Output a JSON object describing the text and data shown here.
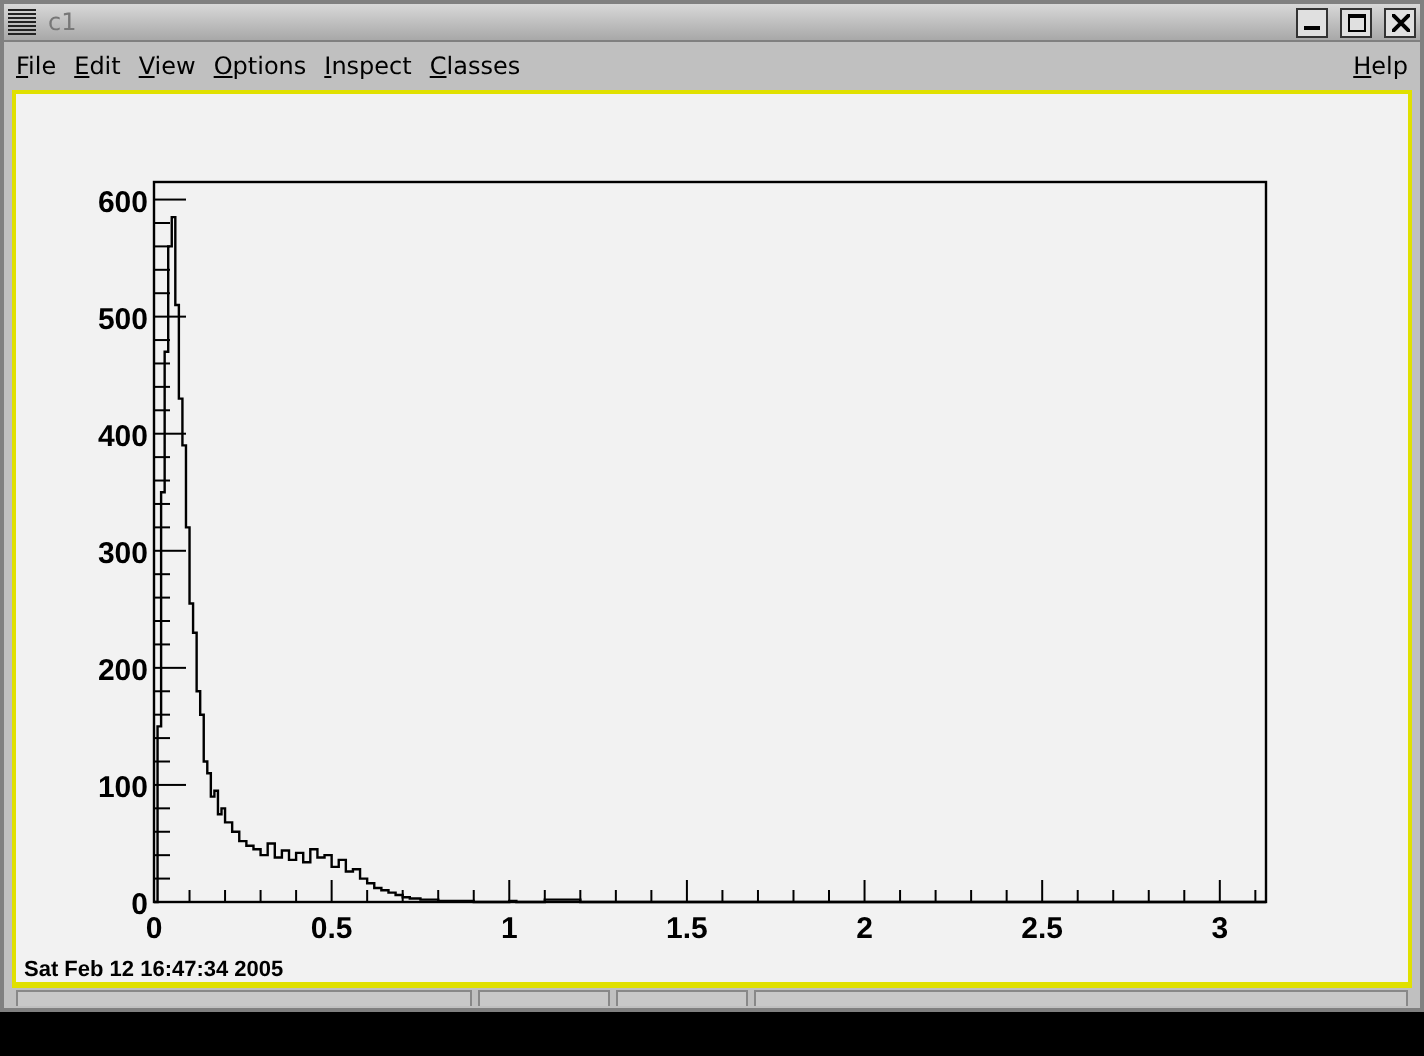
{
  "window": {
    "title": "c1"
  },
  "menu": {
    "items": [
      "File",
      "Edit",
      "View",
      "Options",
      "Inspect",
      "Classes"
    ],
    "help": "Help"
  },
  "canvas": {
    "chart_data": {
      "type": "line",
      "xlim": [
        0,
        3.13
      ],
      "ylim": [
        0,
        615
      ],
      "xticks": [
        0,
        0.5,
        1,
        1.5,
        2,
        2.5,
        3
      ],
      "yticks": [
        0,
        100,
        200,
        300,
        400,
        500,
        600
      ],
      "x": [
        0,
        0.01,
        0.02,
        0.03,
        0.04,
        0.05,
        0.06,
        0.07,
        0.08,
        0.09,
        0.1,
        0.11,
        0.12,
        0.13,
        0.14,
        0.15,
        0.16,
        0.17,
        0.18,
        0.19,
        0.2,
        0.22,
        0.24,
        0.26,
        0.28,
        0.3,
        0.32,
        0.34,
        0.36,
        0.38,
        0.4,
        0.42,
        0.44,
        0.46,
        0.48,
        0.5,
        0.52,
        0.54,
        0.56,
        0.58,
        0.6,
        0.62,
        0.64,
        0.66,
        0.68,
        0.7,
        0.72,
        0.75,
        0.8,
        0.9,
        1.0,
        1.02,
        1.1,
        1.2,
        1.5,
        2,
        2.5,
        3.13
      ],
      "series": [
        {
          "color": "#000000",
          "values": [
            0,
            150,
            350,
            470,
            560,
            585,
            510,
            430,
            390,
            320,
            255,
            230,
            180,
            160,
            120,
            110,
            90,
            95,
            75,
            80,
            68,
            60,
            52,
            48,
            45,
            40,
            50,
            38,
            44,
            36,
            42,
            34,
            45,
            38,
            40,
            30,
            36,
            26,
            28,
            20,
            16,
            12,
            10,
            8,
            6,
            4,
            3,
            2,
            1,
            0,
            1,
            0,
            2,
            0,
            0,
            0,
            0,
            0
          ]
        }
      ]
    }
  },
  "timestamp": "Sat Feb 12 16:47:34 2005"
}
